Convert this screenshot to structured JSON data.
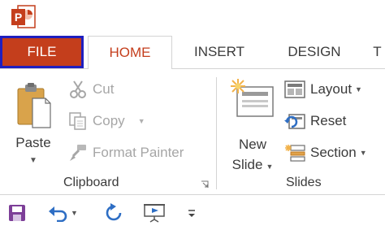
{
  "app": {
    "logo_letter": "P"
  },
  "tabs": {
    "file": "FILE",
    "home": "HOME",
    "insert": "INSERT",
    "design": "DESIGN",
    "more": "T"
  },
  "clipboard": {
    "paste": "Paste",
    "cut": "Cut",
    "copy": "Copy",
    "format_painter": "Format Painter",
    "group_label": "Clipboard"
  },
  "slides": {
    "new_slide_line1": "New",
    "new_slide_line2": "Slide",
    "layout": "Layout",
    "reset": "Reset",
    "section": "Section",
    "group_label": "Slides"
  },
  "colors": {
    "accent": "#c43e1c",
    "file_outline": "#1f1fbf",
    "disabled_text": "#a6a6a6"
  },
  "icons": [
    "powerpoint-logo-icon",
    "paste-icon",
    "cut-icon",
    "copy-icon",
    "format-painter-icon",
    "dialog-launcher-icon",
    "new-slide-icon",
    "layout-icon",
    "reset-icon",
    "section-icon",
    "save-icon",
    "undo-icon",
    "redo-icon",
    "present-icon",
    "customize-icon"
  ]
}
